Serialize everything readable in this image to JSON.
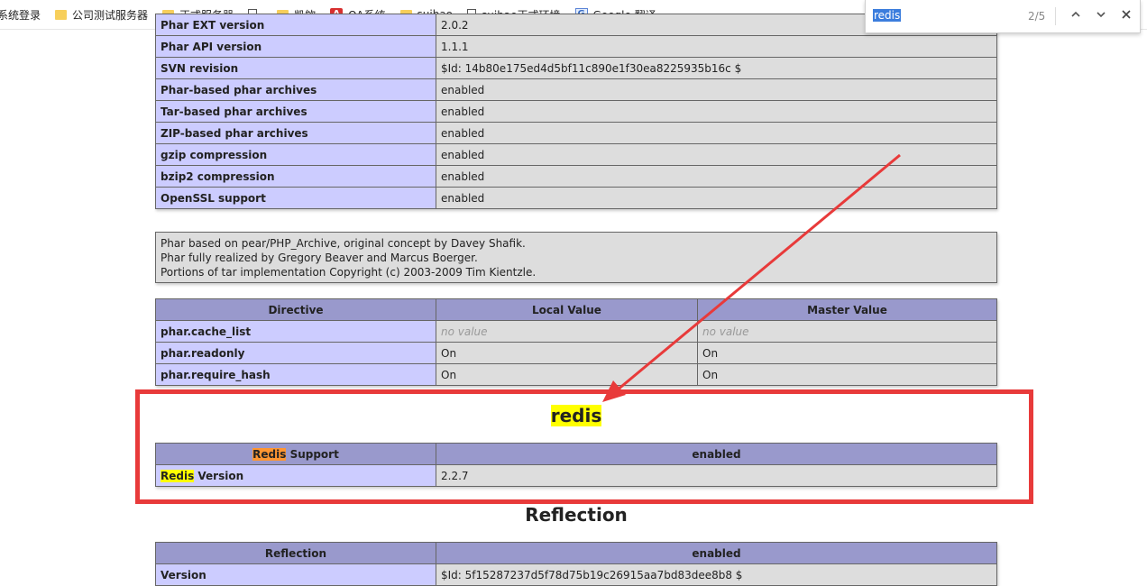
{
  "bookmarks": [
    {
      "label": "系统登录",
      "icon": "none"
    },
    {
      "label": "公司测试服务器",
      "icon": "folder-icon"
    },
    {
      "label": "正式服务器",
      "icon": "folder-icon"
    },
    {
      "label": "",
      "icon": "file-icon"
    },
    {
      "label": "凯欸",
      "icon": "folder-icon"
    },
    {
      "label": "OA系统",
      "icon": "oa-icon"
    },
    {
      "label": "suibao",
      "icon": "folder-icon"
    },
    {
      "label": "suibao正式环境",
      "icon": "file-icon"
    },
    {
      "label": "Google 翻译",
      "icon": "google-translate-icon"
    }
  ],
  "find": {
    "query": "redis",
    "count": "2/5"
  },
  "phar_top_table": [
    {
      "name": "Phar EXT version",
      "value": "2.0.2"
    },
    {
      "name": "Phar API version",
      "value": "1.1.1"
    },
    {
      "name": "SVN revision",
      "value": "$Id: 14b80e175ed4d5bf11c890e1f30ea8225935b16c $"
    },
    {
      "name": "Phar-based phar archives",
      "value": "enabled"
    },
    {
      "name": "Tar-based phar archives",
      "value": "enabled"
    },
    {
      "name": "ZIP-based phar archives",
      "value": "enabled"
    },
    {
      "name": "gzip compression",
      "value": "enabled"
    },
    {
      "name": "bzip2 compression",
      "value": "enabled"
    },
    {
      "name": "OpenSSL support",
      "value": "enabled"
    }
  ],
  "phar_notes": [
    "Phar based on pear/PHP_Archive, original concept by Davey Shafik.",
    "Phar fully realized by Gregory Beaver and Marcus Boerger.",
    "Portions of tar implementation Copyright (c) 2003-2009 Tim Kientzle."
  ],
  "directive_table": {
    "headers": [
      "Directive",
      "Local Value",
      "Master Value"
    ],
    "rows": [
      {
        "name": "phar.cache_list",
        "local": "no value",
        "master": "no value"
      },
      {
        "name": "phar.readonly",
        "local": "On",
        "master": "On"
      },
      {
        "name": "phar.require_hash",
        "local": "On",
        "master": "On"
      }
    ]
  },
  "redis": {
    "title": "redis",
    "support_hl": "Redis",
    "support_rest": " Support",
    "support_value": "enabled",
    "version_hl": "Redis",
    "version_rest": " Version",
    "version_value": "2.2.7"
  },
  "reflection": {
    "title": "Reflection",
    "header_name": "Reflection",
    "header_value": "enabled",
    "row_name": "Version",
    "row_value": "$Id: 5f15287237d5f78d75b19c26915aa7bd83dee8b8 $"
  },
  "colors": {
    "annotation_red": "#e83a3a",
    "find_highlight_yellow": "#ffff00",
    "find_current_orange": "#ff9632",
    "header_purple": "#9999cc",
    "name_cell_lavender": "#ccccff",
    "value_cell_gray": "#dddddd"
  }
}
